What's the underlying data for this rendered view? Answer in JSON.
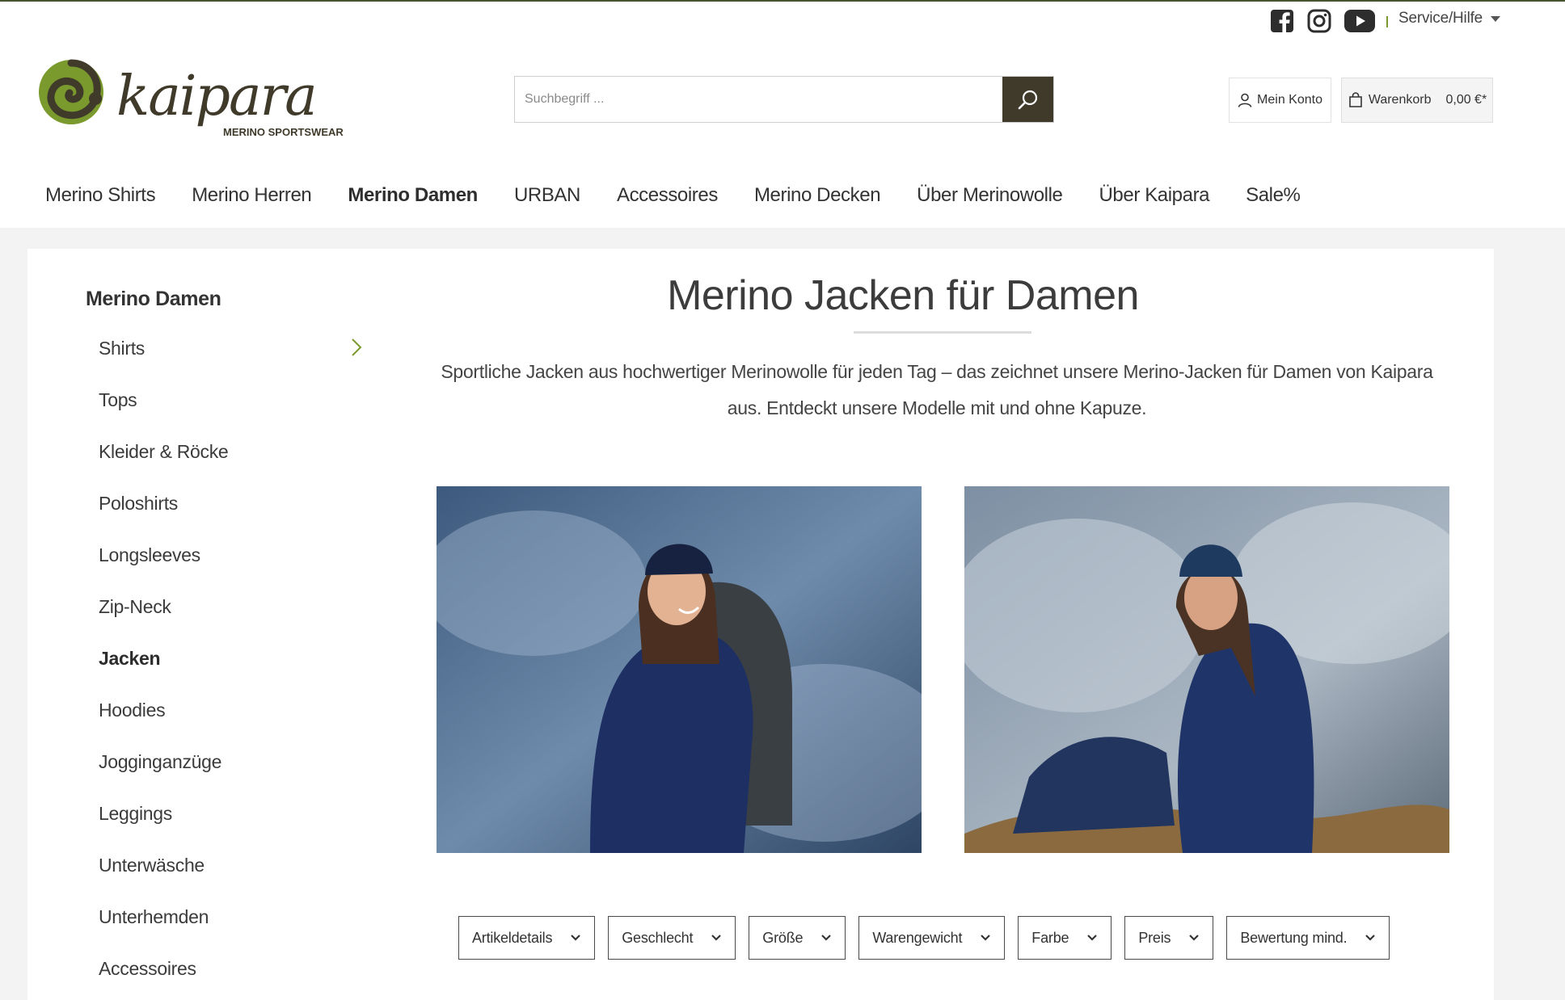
{
  "brand": {
    "name": "kaipara",
    "tagline": "MERINO SPORTSWEAR",
    "accent": "#7a9a2e",
    "dark": "#3f3a2a"
  },
  "topbar": {
    "social": [
      "facebook-icon",
      "instagram-icon",
      "youtube-icon"
    ],
    "service_label": "Service/Hilfe"
  },
  "search": {
    "placeholder": "Suchbegriff ..."
  },
  "account": {
    "label": "Mein Konto"
  },
  "cart": {
    "label": "Warenkorb",
    "total": "0,00 €*"
  },
  "nav": {
    "items": [
      {
        "label": "Merino Shirts"
      },
      {
        "label": "Merino Herren"
      },
      {
        "label": "Merino Damen",
        "active": true
      },
      {
        "label": "URBAN"
      },
      {
        "label": "Accessoires"
      },
      {
        "label": "Merino Decken"
      },
      {
        "label": "Über Merinowolle"
      },
      {
        "label": "Über Kaipara"
      },
      {
        "label": "Sale%"
      }
    ]
  },
  "sidebar": {
    "title": "Merino Damen",
    "items": [
      {
        "label": "Shirts",
        "has_children": true
      },
      {
        "label": "Tops"
      },
      {
        "label": "Kleider & Röcke"
      },
      {
        "label": "Poloshirts"
      },
      {
        "label": "Longsleeves"
      },
      {
        "label": "Zip-Neck"
      },
      {
        "label": "Jacken",
        "active": true
      },
      {
        "label": "Hoodies"
      },
      {
        "label": "Jogginganzüge"
      },
      {
        "label": "Leggings"
      },
      {
        "label": "Unterwäsche"
      },
      {
        "label": "Unterhemden"
      },
      {
        "label": "Accessoires"
      }
    ]
  },
  "main": {
    "title": "Merino Jacken für Damen",
    "intro": "Sportliche Jacken aus hochwertiger Merinowolle für jeden Tag – das zeichnet unsere Merino-Jacken für Damen von Kaipara aus. Entdeckt unsere Modelle mit und ohne Kapuze."
  },
  "filters": [
    {
      "label": "Artikeldetails"
    },
    {
      "label": "Geschlecht"
    },
    {
      "label": "Größe"
    },
    {
      "label": "Warengewicht"
    },
    {
      "label": "Farbe"
    },
    {
      "label": "Preis"
    },
    {
      "label": "Bewertung mind."
    }
  ]
}
